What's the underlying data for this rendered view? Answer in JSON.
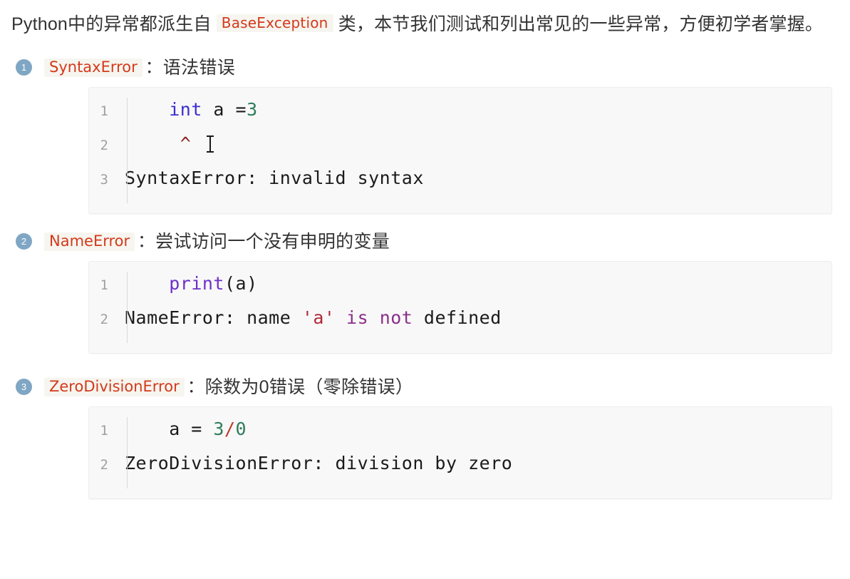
{
  "intro": {
    "before": "Python中的异常都派生自",
    "code": "BaseException",
    "after": "类，本节我们测试和列出常见的一些异常，方便初学者掌握。"
  },
  "colors": {
    "inline_code_text": "#d4391b",
    "inline_code_bg": "#f6f5ef",
    "badge_bg": "#7fa6c4",
    "code_bg": "#f8f8f8",
    "lineno": "#a0a0a0",
    "keyword": "#3b2ecf",
    "function": "#6f30c9",
    "number": "#2e7d5b",
    "string": "#b02a37",
    "operator": "#c0392b",
    "builtin": "#8a2f8a",
    "caret": "#8b1f1f"
  },
  "items": [
    {
      "number": "1",
      "name": "SyntaxError",
      "separator": "：",
      "description": "语法错误",
      "code": {
        "lines": [
          {
            "no": "1",
            "tokens": [
              {
                "text": "    ",
                "cls": "tok-plain"
              },
              {
                "text": "int",
                "cls": "tok-kw"
              },
              {
                "text": " a =",
                "cls": "tok-plain"
              },
              {
                "text": "3",
                "cls": "tok-num"
              }
            ]
          },
          {
            "no": "2",
            "tokens": [
              {
                "text": "     ",
                "cls": "tok-plain"
              },
              {
                "text": "^",
                "cls": "tok-caret"
              }
            ],
            "cursor": true
          },
          {
            "no": "3",
            "tokens": [
              {
                "text": "SyntaxError: invalid syntax",
                "cls": "tok-plain"
              }
            ]
          }
        ]
      }
    },
    {
      "number": "2",
      "name": "NameError",
      "separator": "：",
      "description": "尝试访问一个没有申明的变量",
      "code": {
        "lines": [
          {
            "no": "1",
            "tokens": [
              {
                "text": "    ",
                "cls": "tok-plain"
              },
              {
                "text": "print",
                "cls": "tok-fn"
              },
              {
                "text": "(a)",
                "cls": "tok-plain"
              }
            ]
          },
          {
            "no": "2",
            "tokens": [
              {
                "text": "NameError: name ",
                "cls": "tok-plain"
              },
              {
                "text": "'a'",
                "cls": "tok-str"
              },
              {
                "text": " ",
                "cls": "tok-plain"
              },
              {
                "text": "is not",
                "cls": "tok-builtin"
              },
              {
                "text": " defined",
                "cls": "tok-plain"
              }
            ]
          }
        ]
      }
    },
    {
      "number": "3",
      "name": "ZeroDivisionError",
      "separator": "：",
      "description": "除数为0错误（零除错误）",
      "code": {
        "lines": [
          {
            "no": "1",
            "tokens": [
              {
                "text": "    a = ",
                "cls": "tok-plain"
              },
              {
                "text": "3",
                "cls": "tok-num"
              },
              {
                "text": "/",
                "cls": "tok-op"
              },
              {
                "text": "0",
                "cls": "tok-num"
              }
            ]
          },
          {
            "no": "2",
            "tokens": [
              {
                "text": "ZeroDivisionError: division by zero",
                "cls": "tok-plain"
              }
            ]
          }
        ]
      }
    }
  ]
}
